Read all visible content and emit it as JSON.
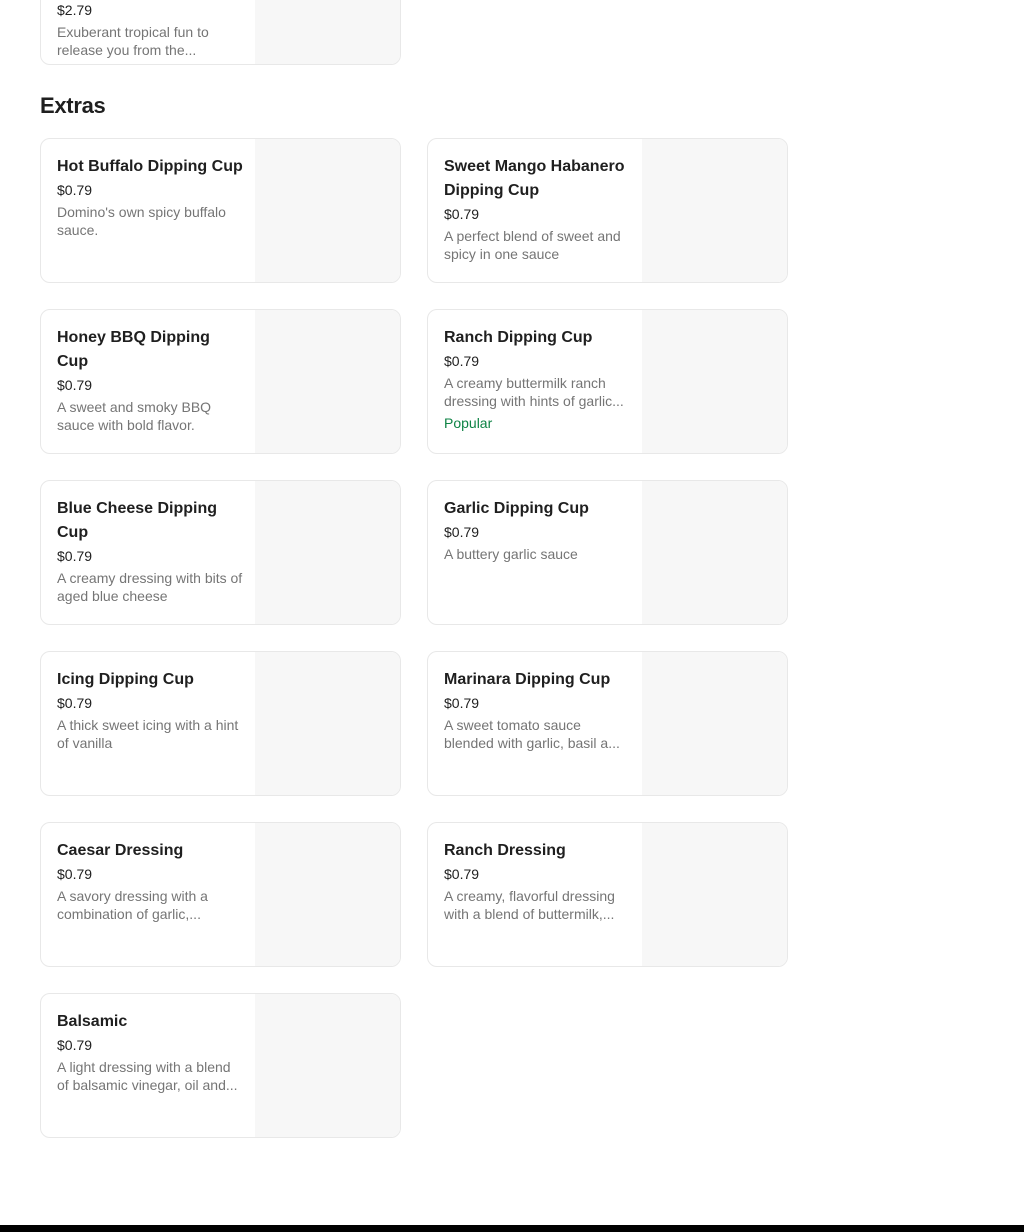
{
  "previous_item": {
    "price": "$2.79",
    "description": "Exuberant tropical fun to release you from the..."
  },
  "extras": {
    "title": "Extras",
    "items": [
      {
        "name": "Hot Buffalo Dipping Cup",
        "price": "$0.79",
        "description": "Domino's own spicy buffalo sauce.",
        "badge": ""
      },
      {
        "name": "Sweet Mango Habanero Dipping Cup",
        "price": "$0.79",
        "description": "A perfect blend of sweet and spicy in one sauce",
        "badge": ""
      },
      {
        "name": "Honey BBQ Dipping Cup",
        "price": "$0.79",
        "description": "A sweet and smoky BBQ sauce with bold flavor.",
        "badge": ""
      },
      {
        "name": "Ranch Dipping Cup",
        "price": "$0.79",
        "description": "A creamy buttermilk ranch dressing with hints of garlic...",
        "badge": "Popular"
      },
      {
        "name": "Blue Cheese Dipping Cup",
        "price": "$0.79",
        "description": "A creamy dressing with bits of aged blue cheese",
        "badge": ""
      },
      {
        "name": "Garlic Dipping Cup",
        "price": "$0.79",
        "description": "A buttery garlic sauce",
        "badge": ""
      },
      {
        "name": "Icing Dipping Cup",
        "price": "$0.79",
        "description": "A thick sweet icing with a hint of vanilla",
        "badge": ""
      },
      {
        "name": "Marinara Dipping Cup",
        "price": "$0.79",
        "description": "A sweet tomato sauce blended with garlic, basil a...",
        "badge": ""
      },
      {
        "name": "Caesar Dressing",
        "price": "$0.79",
        "description": "A savory dressing with a combination of garlic,...",
        "badge": ""
      },
      {
        "name": "Ranch Dressing",
        "price": "$0.79",
        "description": "A creamy, flavorful dressing with a blend of buttermilk,...",
        "badge": ""
      },
      {
        "name": "Balsamic",
        "price": "$0.79",
        "description": "A light dressing with a blend of balsamic vinegar, oil and...",
        "badge": ""
      }
    ]
  },
  "colors": {
    "badge_green": "#0e8345",
    "card_border": "#e8e8e8",
    "thumb_bg": "#f7f7f7"
  }
}
